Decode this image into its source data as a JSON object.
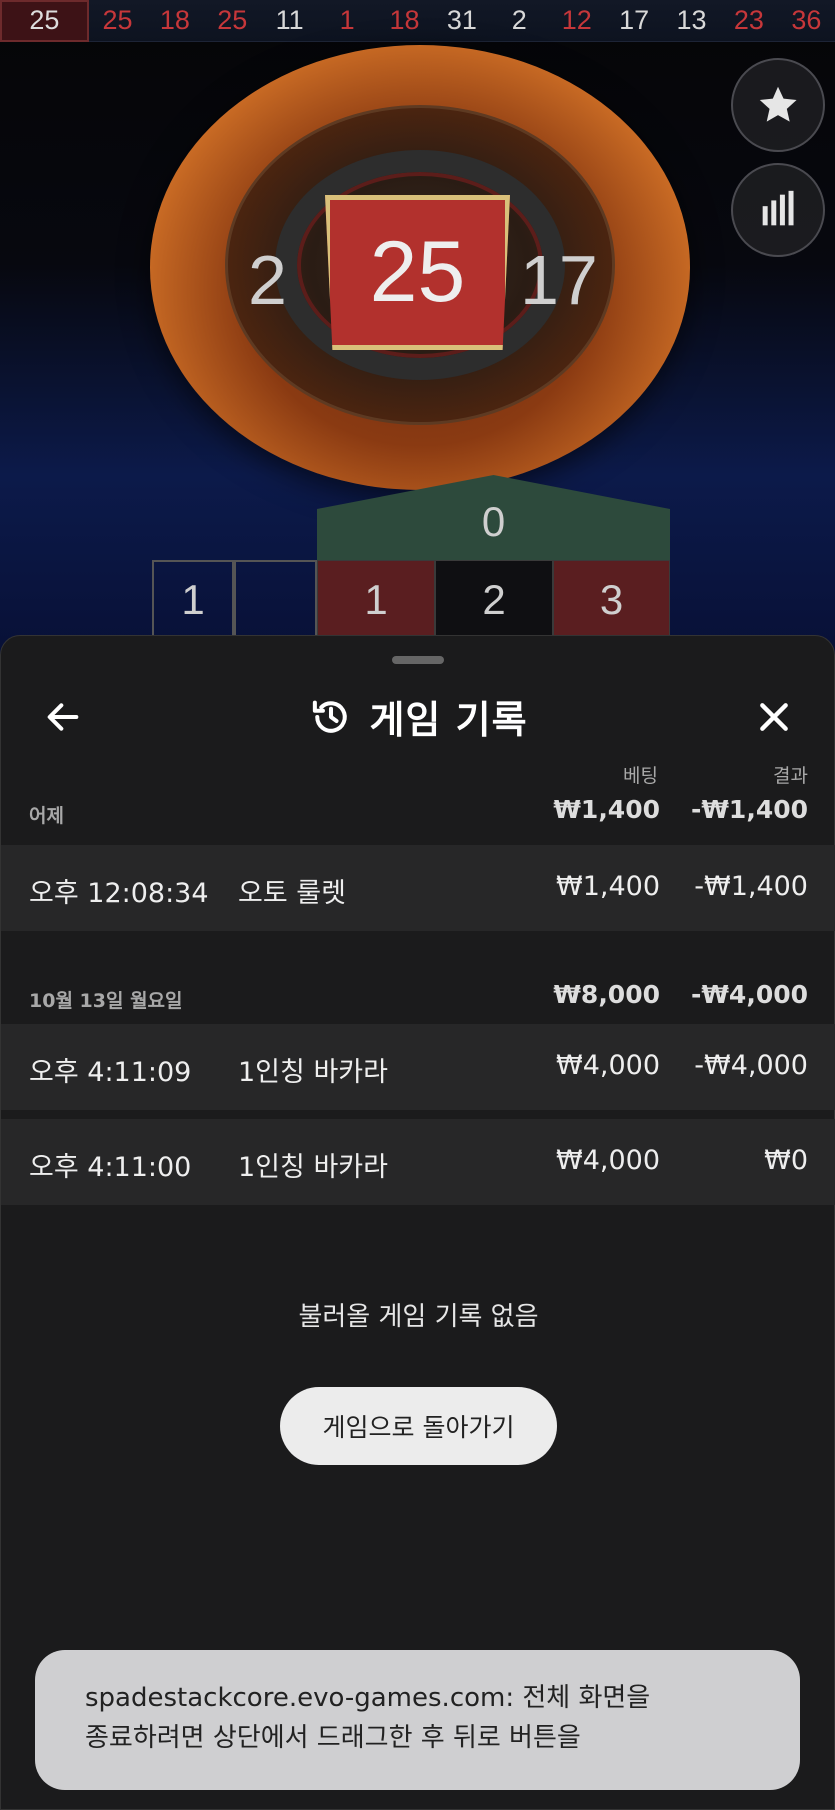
{
  "game": {
    "history_numbers": [
      {
        "n": "25",
        "color": "red"
      },
      {
        "n": "25",
        "color": "red"
      },
      {
        "n": "18",
        "color": "red"
      },
      {
        "n": "25",
        "color": "red"
      },
      {
        "n": "11",
        "color": "black"
      },
      {
        "n": "1",
        "color": "red"
      },
      {
        "n": "18",
        "color": "red"
      },
      {
        "n": "31",
        "color": "black"
      },
      {
        "n": "2",
        "color": "black"
      },
      {
        "n": "12",
        "color": "red"
      },
      {
        "n": "17",
        "color": "black"
      },
      {
        "n": "13",
        "color": "black"
      },
      {
        "n": "23",
        "color": "red"
      },
      {
        "n": "36",
        "color": "red"
      }
    ],
    "result_number": "25",
    "left_neighbor": "2",
    "right_neighbor": "17",
    "table": {
      "zero": "0",
      "c1": "1",
      "c2": "2",
      "c3": "3",
      "side": "1"
    },
    "fab_favorites_icon": "star-icon",
    "fab_stats_icon": "bar-chart-icon"
  },
  "sheet": {
    "title": "게임 기록",
    "col_bet": "베팅",
    "col_result": "결과",
    "groups": [
      {
        "label": "어제",
        "sum_bet": "₩1,400",
        "sum_result": "-₩1,400",
        "rows": [
          {
            "time": "오후 12:08:34",
            "game": "오토 룰렛",
            "bet": "₩1,400",
            "result": "-₩1,400"
          }
        ]
      },
      {
        "label": "10월 13일 월요일",
        "sum_bet": "₩8,000",
        "sum_result": "-₩4,000",
        "rows": [
          {
            "time": "오후 4:11:09",
            "game": "1인칭 바카라",
            "bet": "₩4,000",
            "result": "-₩4,000"
          },
          {
            "time": "오후 4:11:00",
            "game": "1인칭 바카라",
            "bet": "₩4,000",
            "result": "₩0"
          }
        ]
      }
    ],
    "empty_message": "불러올 게임 기록 없음",
    "back_to_game": "게임으로 돌아가기"
  },
  "toast": {
    "line1": "spadestackcore.evo-games.com: 전체 화면을",
    "line2": "종료하려면 상단에서 드래그한 후 뒤로 버튼을"
  },
  "colors": {
    "red": "#c6373a",
    "sheet_bg": "#1b1b1c",
    "row_bg": "#272728"
  }
}
